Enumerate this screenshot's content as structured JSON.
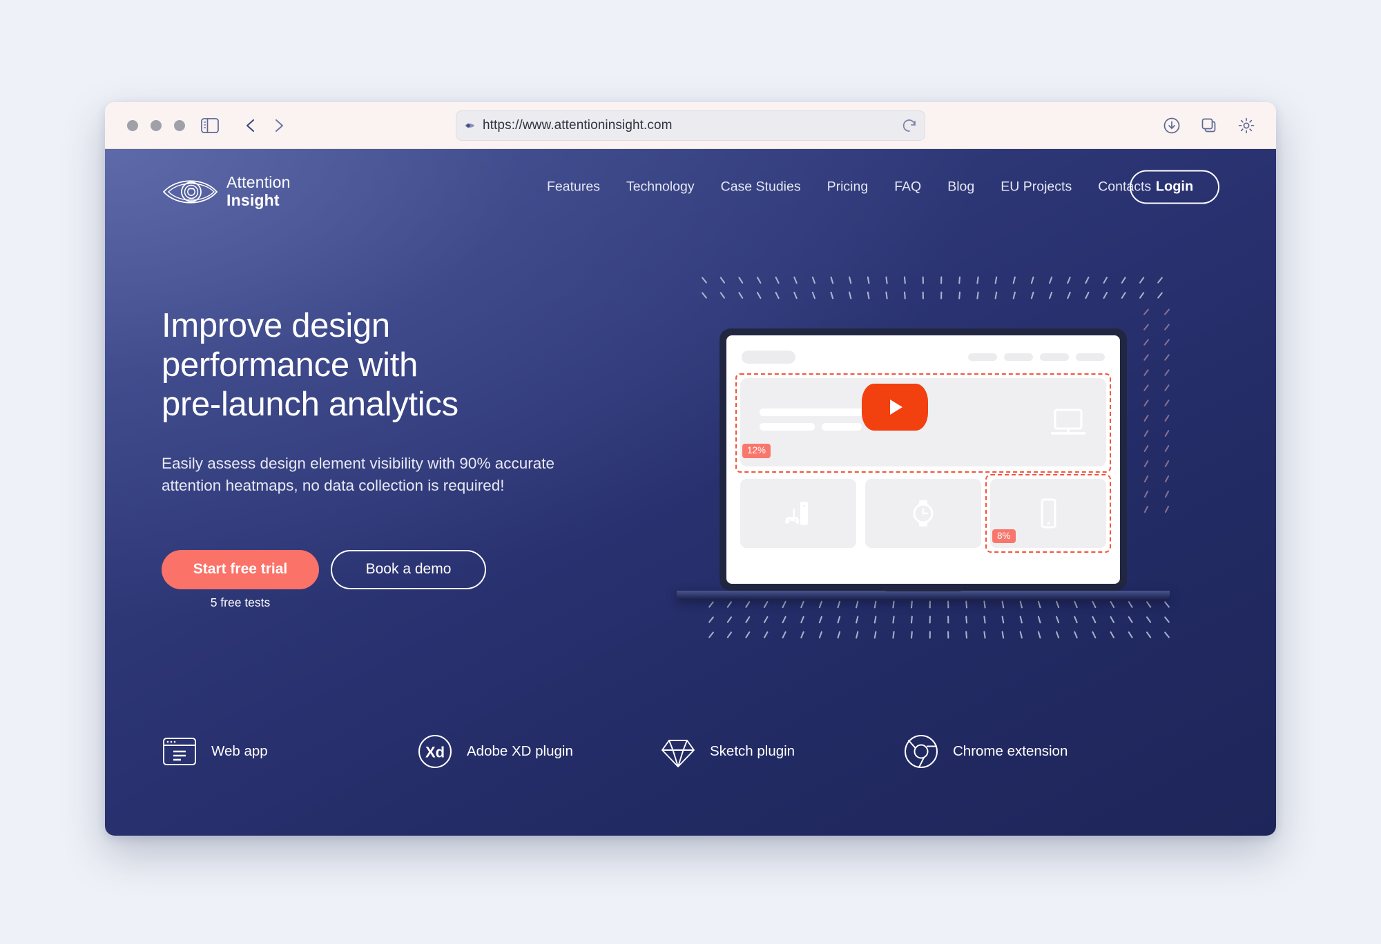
{
  "browser": {
    "url": "https://www.attentioninsight.com",
    "traffic_lights": [
      "close",
      "minimize",
      "maximize"
    ],
    "toolbar_icons": [
      "sidebar-icon",
      "back-arrow-icon",
      "forward-arrow-icon",
      "reload-icon",
      "download-icon",
      "tabs-icon",
      "gear-icon"
    ],
    "url_prefix_icon": "eye-icon"
  },
  "site": {
    "logo": {
      "line1": "Attention",
      "line2": "Insight",
      "icon": "eye-logo-icon"
    },
    "nav": [
      {
        "label": "Features"
      },
      {
        "label": "Technology"
      },
      {
        "label": "Case Studies"
      },
      {
        "label": "Pricing"
      },
      {
        "label": "FAQ"
      },
      {
        "label": "Blog"
      },
      {
        "label": "EU Projects"
      },
      {
        "label": "Contacts"
      }
    ],
    "login_label": "Login"
  },
  "hero": {
    "headline": "Improve design\nperformance with\npre-launch analytics",
    "subtitle": "Easily assess design element visibility with 90% accurate\nattention heatmaps, no data collection is required!",
    "primary_cta": "Start free trial",
    "secondary_cta": "Book a demo",
    "cta_note": "5 free tests"
  },
  "platforms": [
    {
      "label": "Web app",
      "icon": "browser-window-icon"
    },
    {
      "label": "Adobe XD plugin",
      "icon": "adobe-xd-icon"
    },
    {
      "label": "Sketch plugin",
      "icon": "sketch-diamond-icon"
    },
    {
      "label": "Chrome extension",
      "icon": "chrome-icon"
    }
  ],
  "mockup": {
    "play_button": "play-icon",
    "hero_section_icon": "laptop-icon",
    "attention_badges": [
      {
        "value": "12%",
        "region": "hero-banner"
      },
      {
        "value": "8%",
        "region": "mobile-card"
      }
    ],
    "cards": [
      {
        "icon": "game-console-icon"
      },
      {
        "icon": "smartwatch-icon"
      },
      {
        "icon": "smartphone-icon"
      }
    ]
  },
  "colors": {
    "accent_coral": "#fb7268",
    "play_red": "#f2400f",
    "heatmap_dash": "#f2543d",
    "hero_navy": "#28306e",
    "hero_navy_dark": "#1e2559",
    "page_bg": "#eef1f7",
    "chrome_bg": "#fbf3f1"
  }
}
